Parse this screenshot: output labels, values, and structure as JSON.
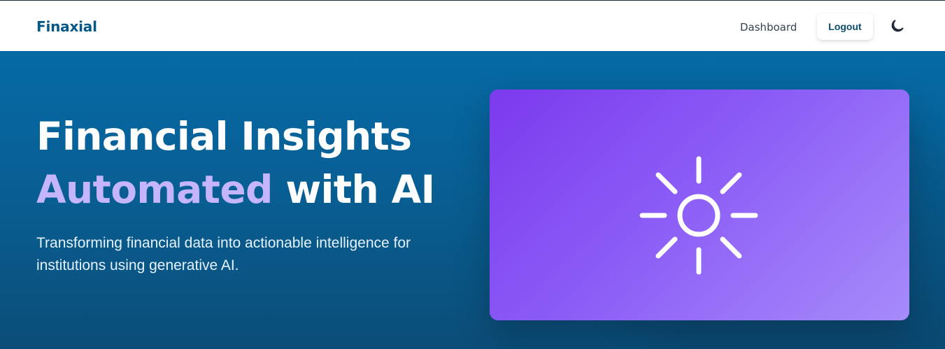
{
  "navbar": {
    "brand": "Finaxial",
    "dashboard_label": "Dashboard",
    "logout_label": "Logout",
    "theme_toggle_icon": "moon-icon"
  },
  "hero": {
    "title_line1": "Financial Insights",
    "title_accent": "Automated",
    "title_rest": " with AI",
    "subtitle": "Transforming financial data into actionable intelligence for institutions using generative AI.",
    "visual_icon": "sun-icon"
  },
  "colors": {
    "brand": "#075985",
    "hero_background_top": "#066aa5",
    "hero_background_bottom": "#0b4d78",
    "accent_text": "#c4b5fd",
    "card_purple_start": "#7c3aed",
    "card_purple_end": "#a78bfa"
  }
}
